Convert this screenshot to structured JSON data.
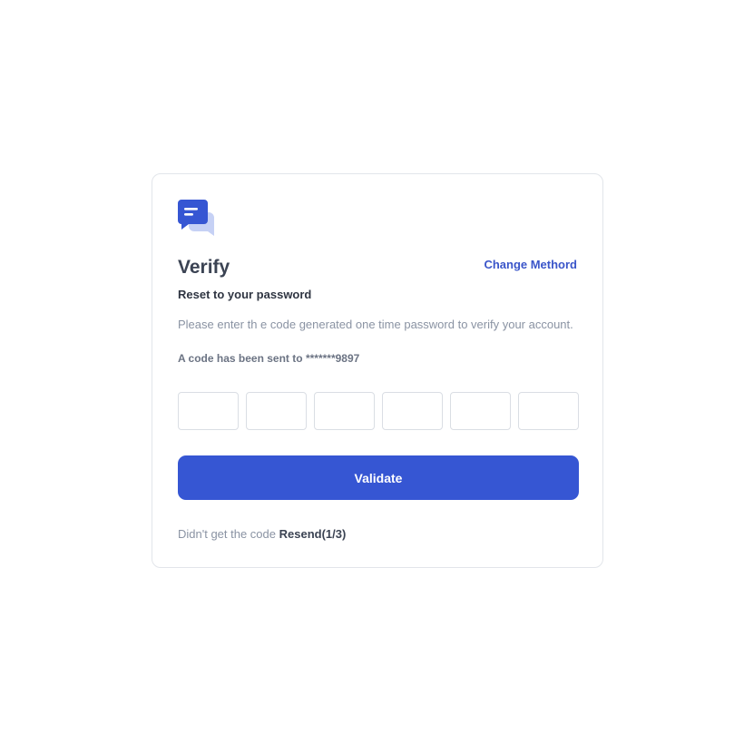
{
  "app": {
    "logo_icon": "chat-bubbles-icon",
    "accent_color": "#3656d3"
  },
  "header": {
    "title": "Verify",
    "change_method_label": "Change Methord"
  },
  "content": {
    "subtitle": "Reset to your password",
    "description": "Please enter th e code generated one time password to verify your account.",
    "sent_prefix": "A code has been sent to",
    "sent_number": "*******9897"
  },
  "otp": {
    "fields": [
      {
        "value": ""
      },
      {
        "value": ""
      },
      {
        "value": ""
      },
      {
        "value": ""
      },
      {
        "value": ""
      },
      {
        "value": ""
      }
    ]
  },
  "actions": {
    "validate_label": "Validate"
  },
  "footer": {
    "prompt": "Didn't get the code",
    "resend_label": "Resend(1/3)"
  }
}
